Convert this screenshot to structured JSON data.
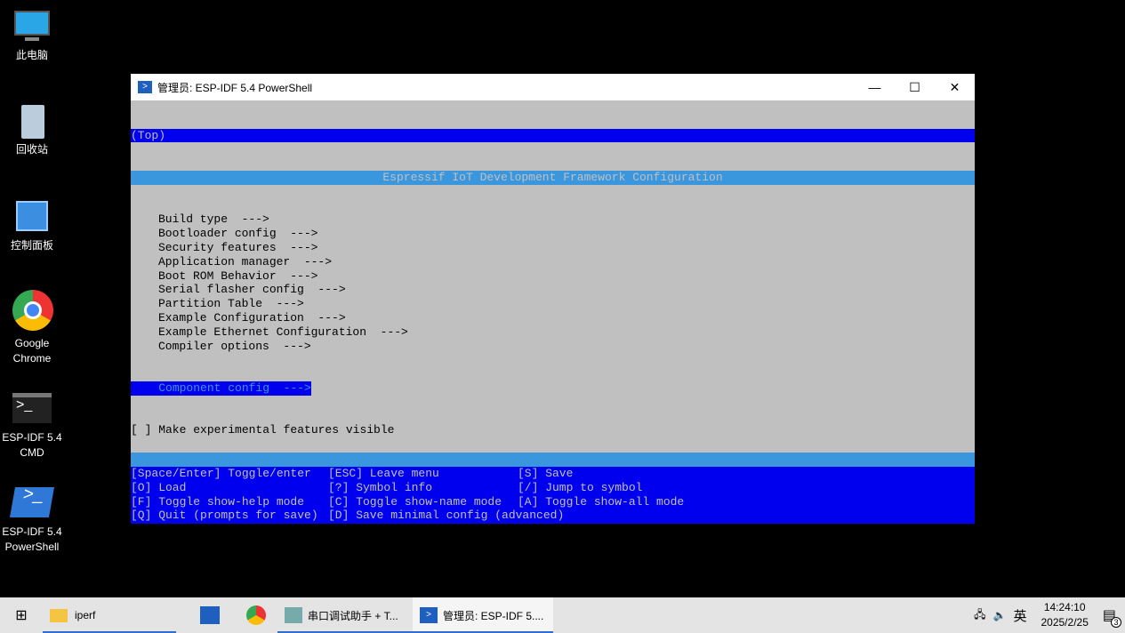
{
  "desktop": [
    {
      "label": "此电脑",
      "icon": "computer-icon"
    },
    {
      "label": "回收站",
      "icon": "recycle-bin-icon"
    },
    {
      "label": "控制面板",
      "icon": "control-panel-icon"
    },
    {
      "label": "Google Chrome",
      "icon": "chrome-icon"
    },
    {
      "label": "ESP-IDF 5.4 CMD",
      "icon": "cmd-icon"
    },
    {
      "label": "ESP-IDF 5.4 PowerShell",
      "icon": "powershell-icon"
    }
  ],
  "window": {
    "title": "管理员: ESP-IDF 5.4 PowerShell",
    "min": "—",
    "max": "☐",
    "close": "✕"
  },
  "menu": {
    "breadcrumb": "(Top)",
    "header": "Espressif IoT Development Framework Configuration",
    "items": [
      "Build type  --->",
      "Bootloader config  --->",
      "Security features  --->",
      "Application manager  --->",
      "Boot ROM Behavior  --->",
      "Serial flasher config  --->",
      "Partition Table  --->",
      "Example Configuration  --->",
      "Example Ethernet Configuration  --->",
      "Compiler options  --->"
    ],
    "selected": "Component config  --->",
    "checkbox": "[ ] Make experimental features visible"
  },
  "help": [
    [
      "[Space/Enter] Toggle/enter",
      "[ESC] Leave menu",
      "[S] Save"
    ],
    [
      "[O] Load",
      "[?] Symbol info",
      "[/] Jump to symbol"
    ],
    [
      "[F] Toggle show-help mode",
      "[C] Toggle show-name mode",
      "[A] Toggle show-all mode"
    ],
    [
      "[Q] Quit (prompts for save)",
      "[D] Save minimal config (advanced)",
      ""
    ]
  ],
  "taskbar": {
    "folder": "iperf",
    "serial": "串口调试助手 + T...",
    "ps": "管理员: ESP-IDF 5....",
    "ime": "英",
    "time": "14:24:10",
    "date": "2025/2/25",
    "notifications": "3"
  }
}
